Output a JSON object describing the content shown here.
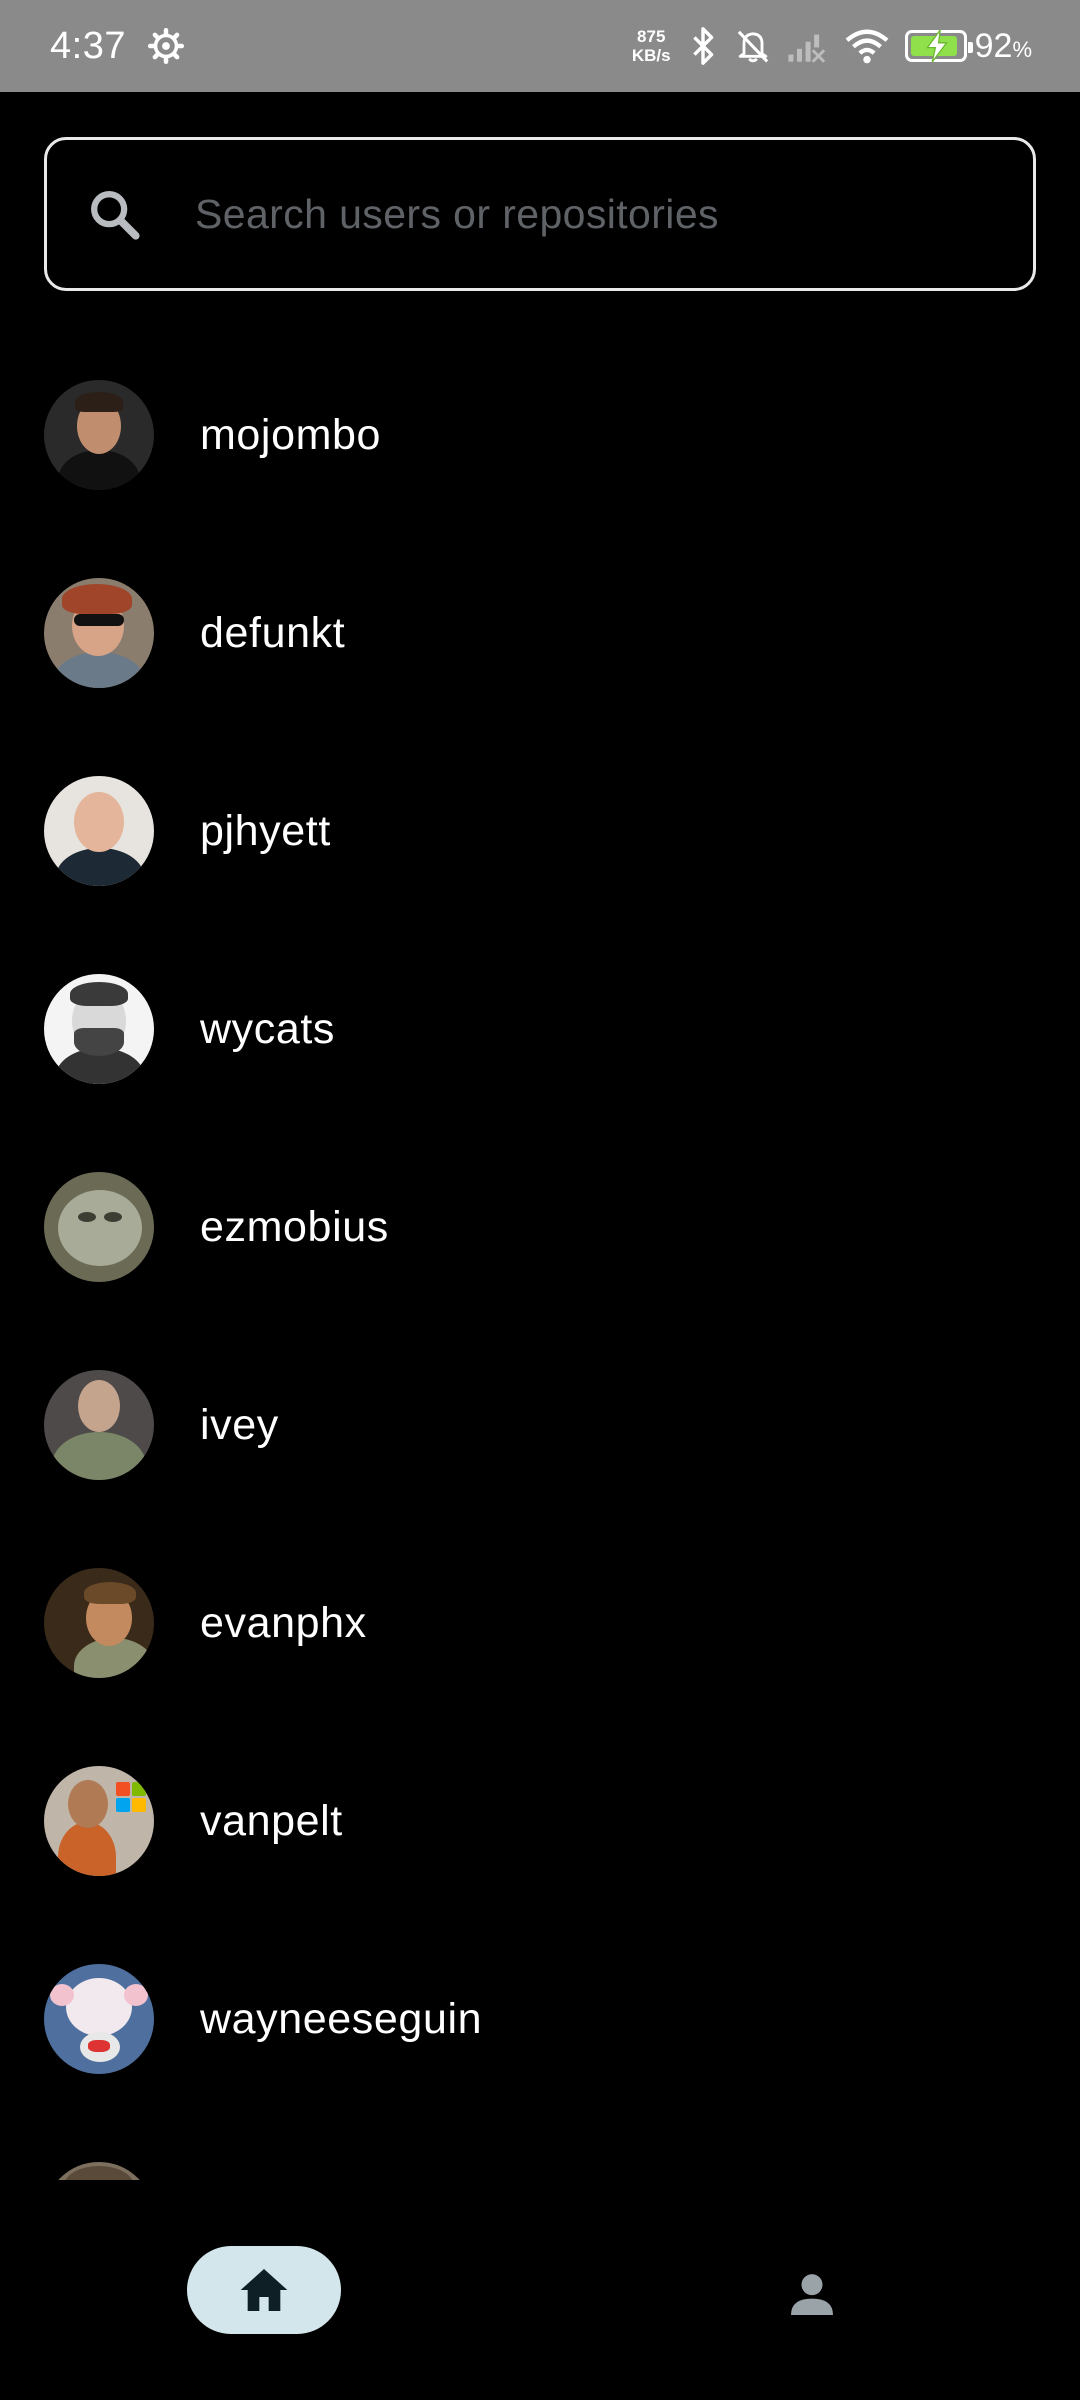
{
  "status_bar": {
    "time": "4:37",
    "net_speed_value": "875",
    "net_speed_unit": "KB/s",
    "battery_percent": "92",
    "battery_unit": "%",
    "battery_level": 0.92
  },
  "search": {
    "placeholder": "Search users or repositories",
    "value": ""
  },
  "users": [
    {
      "login": "mojombo"
    },
    {
      "login": "defunkt"
    },
    {
      "login": "pjhyett"
    },
    {
      "login": "wycats"
    },
    {
      "login": "ezmobius"
    },
    {
      "login": "ivey"
    },
    {
      "login": "evanphx"
    },
    {
      "login": "vanpelt"
    },
    {
      "login": "wayneeseguin"
    }
  ],
  "bottom_nav": {
    "items": [
      {
        "icon": "home-icon",
        "selected": true
      },
      {
        "icon": "person-icon",
        "selected": false
      }
    ]
  },
  "colors": {
    "background": "#000000",
    "status_bar": "#8a8a8a",
    "nav_selected_pill": "#d3e6ec",
    "nav_unselected_icon": "#9aa3a8",
    "search_border": "#e9e9e9",
    "placeholder": "#5f6266"
  }
}
